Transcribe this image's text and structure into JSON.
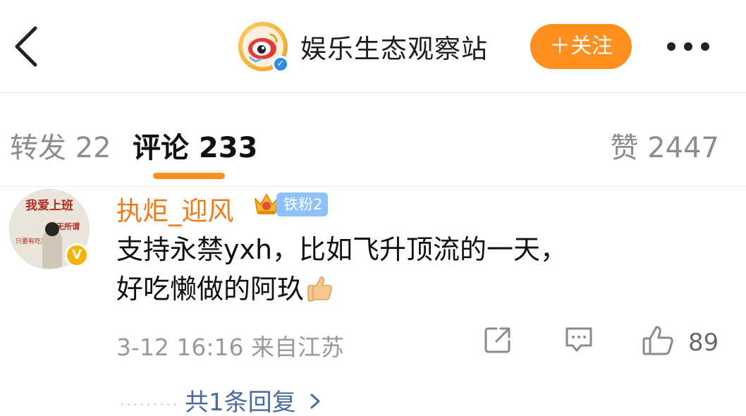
{
  "header": {
    "back_icon": "chevron-left-icon",
    "account_name": "娱乐生态观察站",
    "follow_label": "＋关注",
    "more_icon": "more-dots-icon"
  },
  "tabs": [
    {
      "label": "转发 22"
    },
    {
      "label": "评论 233"
    },
    {
      "label": "赞 2447"
    }
  ],
  "comment": {
    "username": "执炬_迎风",
    "fan_badge": "铁粉2",
    "avatar_text": [
      "我爱上班",
      "无所谓",
      "只要有吃害"
    ],
    "text_lines": [
      "支持永禁yxh，比如飞升顶流的一天，",
      "好吃懒做的阿玖"
    ],
    "meta": "3-12 16:16 来自江苏",
    "like_count": "89",
    "replies_label": "共1条回复",
    "dots": "·········"
  },
  "colors": {
    "accent_orange": "#ff8f1f",
    "username_orange": "#ef7a1a",
    "reply_link": "#4a6aa0",
    "badge_blue": "#8fc1ff"
  }
}
